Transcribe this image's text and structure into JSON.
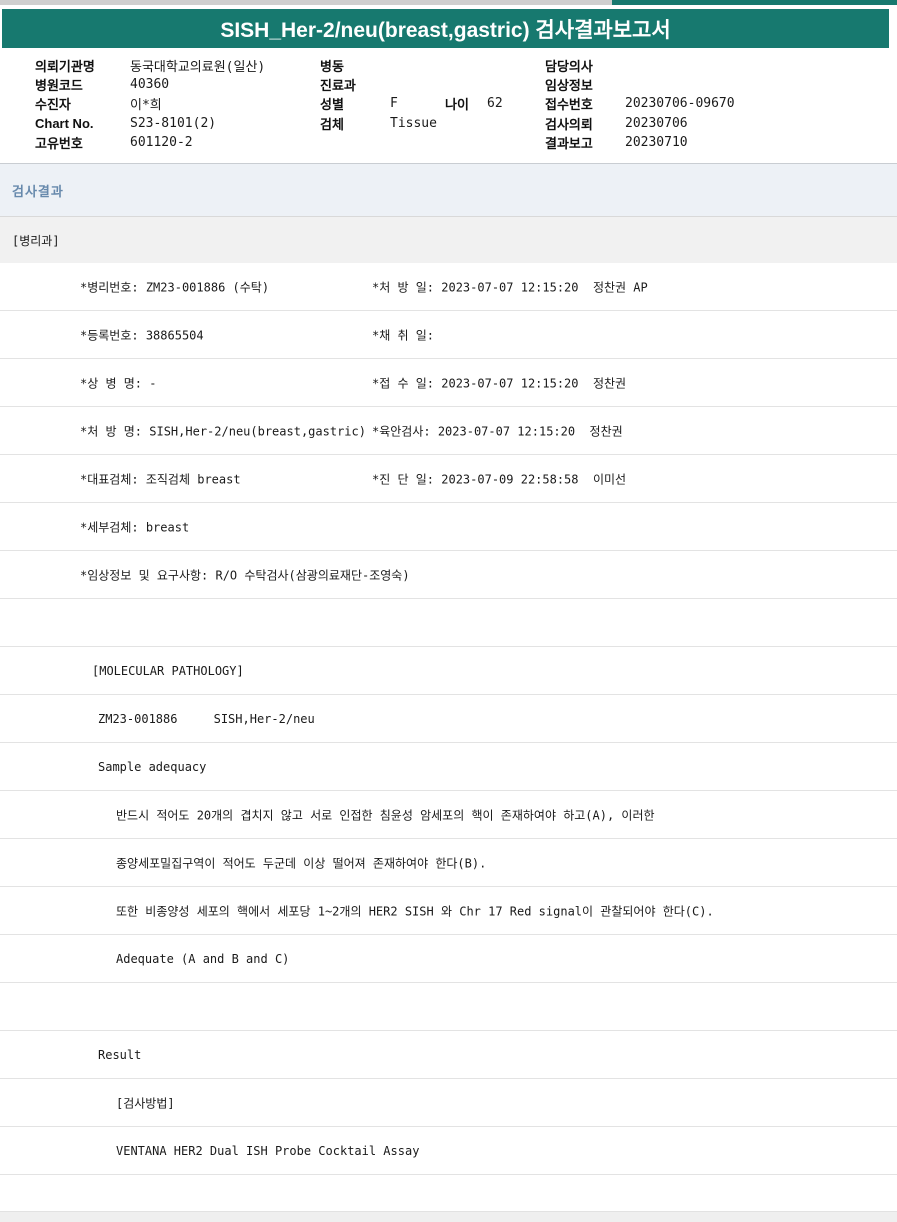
{
  "title": "SISH_Her-2/neu(breast,gastric) 검사결과보고서",
  "patient_info": {
    "col1": [
      {
        "label": "의뢰기관명",
        "value": "동국대학교의료원(일산)"
      },
      {
        "label": "병원코드",
        "value": "40360"
      },
      {
        "label": "수진자",
        "value": "이*희"
      },
      {
        "label": "Chart No.",
        "value": "S23-8101(2)"
      },
      {
        "label": "고유번호",
        "value": "601120-2"
      }
    ],
    "col2": [
      {
        "label": "병동",
        "value": ""
      },
      {
        "label": "진료과",
        "value": ""
      },
      {
        "label": "성별",
        "value": "F",
        "label2": "나이",
        "value2": "62"
      },
      {
        "label": "검체",
        "value": "Tissue"
      }
    ],
    "col3": [
      {
        "label": "담당의사",
        "value": ""
      },
      {
        "label": "임상정보",
        "value": ""
      },
      {
        "label": "접수번호",
        "value": "20230706-09670"
      },
      {
        "label": "검사의뢰",
        "value": "20230706"
      },
      {
        "label": "결과보고",
        "value": "20230710"
      }
    ]
  },
  "section": {
    "results_header": "검사결과",
    "department": "[병리과]"
  },
  "rows": [
    {
      "left": "*병리번호: ZM23-001886 (수탁)",
      "right": "*처 방 일: 2023-07-07 12:15:20  정찬권 AP"
    },
    {
      "left": "*등록번호: 38865504",
      "right": "*채 취 일:"
    },
    {
      "left": "*상 병 명: -",
      "right": "*접 수 일: 2023-07-07 12:15:20  정찬권"
    },
    {
      "left": "*처 방 명: SISH,Her-2/neu(breast,gastric)",
      "right": "*육안검사: 2023-07-07 12:15:20  정찬권"
    },
    {
      "left": "*대표검체: 조직검체 breast",
      "right": "*진 단 일: 2023-07-09 22:58:58  이미선"
    },
    {
      "left": "*세부검체: breast",
      "right": ""
    },
    {
      "left": "*임상정보 및 요구사항: R/O 수탁검사(삼광의료재단-조영숙)",
      "right": ""
    },
    {
      "left": "",
      "right": ""
    },
    {
      "left": "[MOLECULAR PATHOLOGY]",
      "right": ""
    },
    {
      "left": "ZM23-001886     SISH,Her-2/neu",
      "right": ""
    },
    {
      "left": "Sample adequacy",
      "right": ""
    },
    {
      "left": "반드시 적어도 20개의 겹치지 않고 서로 인접한 침윤성 암세포의 핵이 존재하여야 하고(A), 이러한",
      "right": ""
    },
    {
      "left": "종양세포밀집구역이 적어도 두군데 이상 떨어져 존재하여야 한다(B).",
      "right": ""
    },
    {
      "left": "또한 비종양성 세포의 핵에서 세포당 1~2개의 HER2 SISH 와 Chr 17 Red signal이 관찰되어야 한다(C).",
      "right": ""
    },
    {
      "left": "Adequate (A and B and C)",
      "right": ""
    },
    {
      "left": "",
      "right": ""
    },
    {
      "left": "Result",
      "right": ""
    },
    {
      "left": "[검사방법]",
      "right": ""
    },
    {
      "left": "VENTANA HER2 Dual ISH Probe Cocktail Assay",
      "right": ""
    }
  ],
  "colors": {
    "accent_teal": "#17796f",
    "results_band_bg": "#edf1f6",
    "results_text": "#6789ac",
    "dept_band_bg": "#f1f1f1",
    "divider": "#e3e3e3"
  }
}
